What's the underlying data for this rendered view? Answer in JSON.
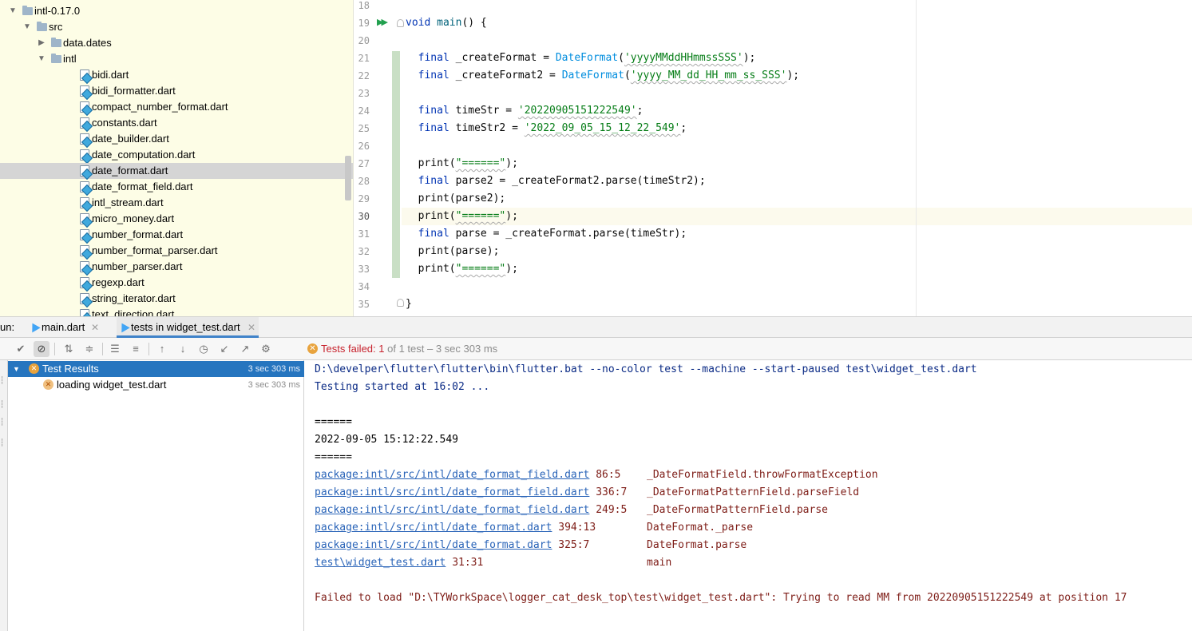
{
  "project_tree": {
    "items": [
      {
        "label": "intl-0.17.0",
        "type": "folder",
        "expanded": true,
        "depth": 0
      },
      {
        "label": "src",
        "type": "folder",
        "expanded": true,
        "depth": 1
      },
      {
        "label": "data.dates",
        "type": "folder",
        "expanded": false,
        "depth": 2
      },
      {
        "label": "intl",
        "type": "folder",
        "expanded": true,
        "depth": 2
      },
      {
        "label": "bidi.dart",
        "type": "file",
        "depth": 3
      },
      {
        "label": "bidi_formatter.dart",
        "type": "file",
        "depth": 3
      },
      {
        "label": "compact_number_format.dart",
        "type": "file",
        "depth": 3
      },
      {
        "label": "constants.dart",
        "type": "file",
        "depth": 3
      },
      {
        "label": "date_builder.dart",
        "type": "file",
        "depth": 3
      },
      {
        "label": "date_computation.dart",
        "type": "file",
        "depth": 3
      },
      {
        "label": "date_format.dart",
        "type": "file",
        "depth": 3,
        "selected": true
      },
      {
        "label": "date_format_field.dart",
        "type": "file",
        "depth": 3
      },
      {
        "label": "intl_stream.dart",
        "type": "file",
        "depth": 3
      },
      {
        "label": "micro_money.dart",
        "type": "file",
        "depth": 3
      },
      {
        "label": "number_format.dart",
        "type": "file",
        "depth": 3
      },
      {
        "label": "number_format_parser.dart",
        "type": "file",
        "depth": 3
      },
      {
        "label": "number_parser.dart",
        "type": "file",
        "depth": 3
      },
      {
        "label": "regexp.dart",
        "type": "file",
        "depth": 3
      },
      {
        "label": "string_iterator.dart",
        "type": "file",
        "depth": 3
      },
      {
        "label": "text_direction.dart",
        "type": "file",
        "depth": 3
      }
    ]
  },
  "editor": {
    "lines": [
      {
        "n": "18",
        "code": ""
      },
      {
        "n": "19",
        "code": "void main() {"
      },
      {
        "n": "20",
        "code": ""
      },
      {
        "n": "21",
        "code": "  final _createFormat = DateFormat('yyyyMMddHHmmssSSS');"
      },
      {
        "n": "22",
        "code": "  final _createFormat2 = DateFormat('yyyy_MM_dd_HH_mm_ss_SSS');"
      },
      {
        "n": "23",
        "code": ""
      },
      {
        "n": "24",
        "code": "  final timeStr = '20220905151222549';"
      },
      {
        "n": "25",
        "code": "  final timeStr2 = '2022_09_05_15_12_22_549';"
      },
      {
        "n": "26",
        "code": ""
      },
      {
        "n": "27",
        "code": "  print(\"======\");"
      },
      {
        "n": "28",
        "code": "  final parse2 = _createFormat2.parse(timeStr2);"
      },
      {
        "n": "29",
        "code": "  print(parse2);"
      },
      {
        "n": "30",
        "code": "  print(\"======\");"
      },
      {
        "n": "31",
        "code": "  final parse = _createFormat.parse(timeStr);"
      },
      {
        "n": "32",
        "code": "  print(parse);"
      },
      {
        "n": "33",
        "code": "  print(\"======\");"
      },
      {
        "n": "34",
        "code": ""
      },
      {
        "n": "35",
        "code": "}"
      }
    ]
  },
  "run_panel": {
    "label": "un:",
    "tabs": [
      {
        "label": "main.dart",
        "active": false
      },
      {
        "label": "tests in widget_test.dart",
        "active": true
      }
    ],
    "status": {
      "prefix": "Tests failed: ",
      "failed": "1",
      "suffix": " of 1 test",
      "duration": " – 3 sec 303 ms"
    },
    "test_tree": [
      {
        "label": "Test Results",
        "time": "3 sec 303 ms",
        "selected": true
      },
      {
        "label": "loading widget_test.dart",
        "time": "3 sec 303 ms",
        "selected": false
      }
    ]
  },
  "console": {
    "lines": [
      {
        "kind": "sys",
        "text": "D:\\develper\\flutter\\flutter\\bin\\flutter.bat --no-color test --machine --start-paused test\\widget_test.dart"
      },
      {
        "kind": "sys",
        "text": "Testing started at 16:02 ..."
      },
      {
        "kind": "blank",
        "text": ""
      },
      {
        "kind": "out",
        "text": "======"
      },
      {
        "kind": "out",
        "text": "2022-09-05 15:12:22.549"
      },
      {
        "kind": "out",
        "text": "======"
      },
      {
        "kind": "trace",
        "link": "package:intl/src/intl/date_format_field.dart",
        "loc": " 86:5",
        "member": "_DateFormatField.throwFormatException"
      },
      {
        "kind": "trace",
        "link": "package:intl/src/intl/date_format_field.dart",
        "loc": " 336:7",
        "member": "_DateFormatPatternField.parseField"
      },
      {
        "kind": "trace",
        "link": "package:intl/src/intl/date_format_field.dart",
        "loc": " 249:5",
        "member": "_DateFormatPatternField.parse"
      },
      {
        "kind": "trace",
        "link": "package:intl/src/intl/date_format.dart",
        "loc": " 394:13",
        "member": "DateFormat._parse"
      },
      {
        "kind": "trace",
        "link": "package:intl/src/intl/date_format.dart",
        "loc": " 325:7",
        "member": "DateFormat.parse"
      },
      {
        "kind": "trace",
        "link": "test\\widget_test.dart",
        "loc": " 31:31",
        "member": "main"
      },
      {
        "kind": "blank",
        "text": ""
      },
      {
        "kind": "err",
        "text": "Failed to load \"D:\\TYWorkSpace\\logger_cat_desk_top\\test\\widget_test.dart\": Trying to read MM from 20220905151222549 at position 17"
      }
    ]
  },
  "colors": {
    "tree_bg": "#fdfde6",
    "selection": "#2675bf",
    "keyword": "#0033b3",
    "string": "#067d17",
    "class": "#008dde",
    "error_text": "#7e1d17",
    "link": "#2a64b8",
    "status_fail": "#c7222d"
  }
}
